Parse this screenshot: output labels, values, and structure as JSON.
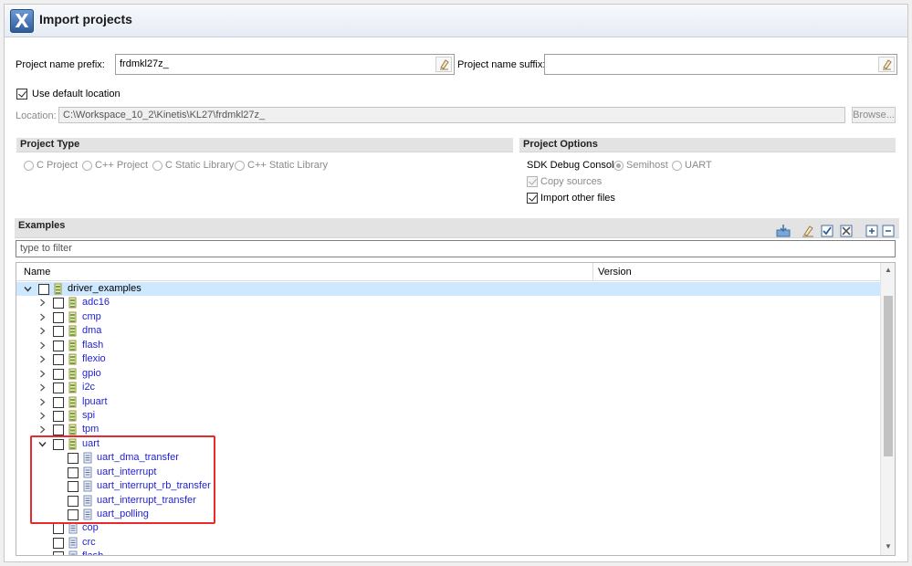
{
  "header": {
    "title": "Import projects",
    "icon": "x-logo-icon"
  },
  "form": {
    "prefix_label": "Project name prefix:",
    "prefix_value": "frdmkl27z_",
    "suffix_label": "Project name suffix:",
    "suffix_value": "",
    "use_default_location_label": "Use default location",
    "use_default_location_checked": true,
    "location_label": "Location:",
    "location_value": "C:\\Workspace_10_2\\Kinetis\\KL27\\frdmkl27z_",
    "browse_label": "Browse..."
  },
  "project_type": {
    "title": "Project Type",
    "options": [
      "C Project",
      "C++ Project",
      "C Static Library",
      "C++ Static Library"
    ]
  },
  "project_options": {
    "title": "Project Options",
    "sdk_debug_console_label": "SDK Debug Console",
    "console_options": [
      "Semihost",
      "UART"
    ],
    "console_selected": "Semihost",
    "copy_sources_label": "Copy sources",
    "copy_sources_checked": true,
    "import_other_files_label": "Import other files",
    "import_other_files_checked": true
  },
  "examples": {
    "title": "Examples",
    "filter_placeholder": "type to filter",
    "columns": {
      "name": "Name",
      "version": "Version"
    },
    "tree": [
      {
        "label": "driver_examples",
        "level": 0,
        "expanded": true,
        "kind": "folder",
        "selected": true
      },
      {
        "label": "adc16",
        "level": 1,
        "expanded": false,
        "kind": "folder"
      },
      {
        "label": "cmp",
        "level": 1,
        "expanded": false,
        "kind": "folder"
      },
      {
        "label": "dma",
        "level": 1,
        "expanded": false,
        "kind": "folder"
      },
      {
        "label": "flash",
        "level": 1,
        "expanded": false,
        "kind": "folder"
      },
      {
        "label": "flexio",
        "level": 1,
        "expanded": false,
        "kind": "folder"
      },
      {
        "label": "gpio",
        "level": 1,
        "expanded": false,
        "kind": "folder"
      },
      {
        "label": "i2c",
        "level": 1,
        "expanded": false,
        "kind": "folder"
      },
      {
        "label": "lpuart",
        "level": 1,
        "expanded": false,
        "kind": "folder"
      },
      {
        "label": "spi",
        "level": 1,
        "expanded": false,
        "kind": "folder"
      },
      {
        "label": "tpm",
        "level": 1,
        "expanded": false,
        "kind": "folder"
      },
      {
        "label": "uart",
        "level": 1,
        "expanded": true,
        "kind": "folder"
      },
      {
        "label": "uart_dma_transfer",
        "level": 2,
        "kind": "project"
      },
      {
        "label": "uart_interrupt",
        "level": 2,
        "kind": "project"
      },
      {
        "label": "uart_interrupt_rb_transfer",
        "level": 2,
        "kind": "project"
      },
      {
        "label": "uart_interrupt_transfer",
        "level": 2,
        "kind": "project"
      },
      {
        "label": "uart_polling",
        "level": 2,
        "kind": "project"
      },
      {
        "label": "cop",
        "level": 1,
        "kind": "project"
      },
      {
        "label": "crc",
        "level": 1,
        "kind": "project"
      },
      {
        "label": "flash",
        "level": 1,
        "kind": "project"
      }
    ]
  },
  "colors": {
    "link": "#1f1fd6",
    "selection": "#cde8ff",
    "highlight_box": "#e52b2b"
  }
}
